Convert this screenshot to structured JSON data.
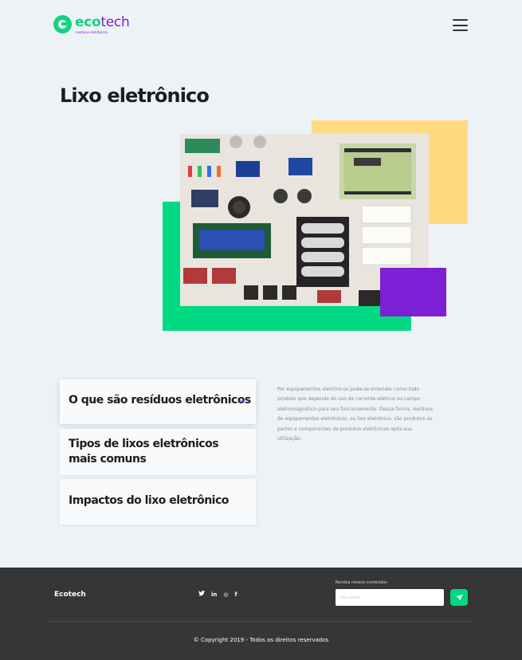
{
  "brand": {
    "logo_eco": "eco",
    "logo_tech": "tech",
    "logo_tagline": "resíduos eletrônicos",
    "icon": "ecotech-logo-icon",
    "colors": {
      "green": "#00d882",
      "purple": "#7b1fd6",
      "yellow": "#ffdb80"
    }
  },
  "header": {
    "menu_icon": "hamburger-menu-icon"
  },
  "page": {
    "title": "Lixo eletrônico"
  },
  "hero": {
    "image": "electronic-components-photo"
  },
  "topics": [
    {
      "label": "O que são resíduos eletrônicos",
      "active": true,
      "arrow": "→"
    },
    {
      "label": "Tipos de lixos eletrônicos mais comuns",
      "active": false
    },
    {
      "label": "Impactos do lixo eletrônico",
      "active": false
    }
  ],
  "description": "Por equipamentos eletrônicos pode-se entender como todo produto que dependa do uso de corrente elétrica ou campo eletromagnético para seu funcionamento. Dessa forma, resíduos de equipamentos eletrônicos, ou lixo eletrônico, são produtos ou partes e componentes de produtos eletrônicos após sua utilização.",
  "footer": {
    "brand": "Ecotech",
    "social": [
      {
        "icon": "twitter-icon",
        "glyph": "𝕥"
      },
      {
        "icon": "linkedin-icon",
        "glyph": "in"
      },
      {
        "icon": "instagram-icon",
        "glyph": "◎"
      },
      {
        "icon": "facebook-icon",
        "glyph": "f"
      }
    ],
    "newsletter_label": "Receba nossos conteúdos",
    "newsletter_placeholder": "seu email",
    "send_icon": "send-icon",
    "copyright": "© Copyright 2019 - Todos os direitos reservados"
  }
}
